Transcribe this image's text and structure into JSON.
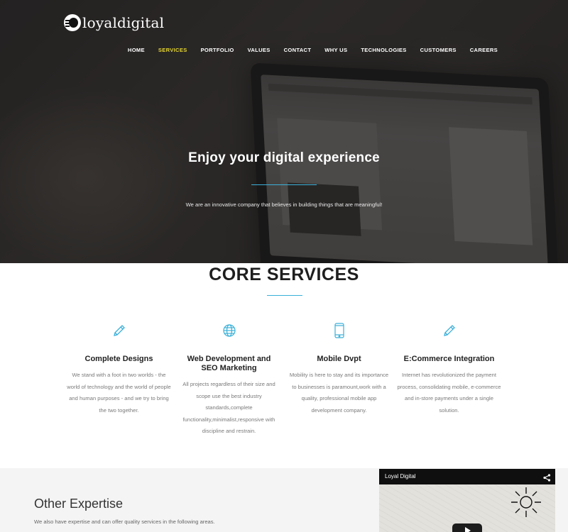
{
  "brand": {
    "name": "loyaldigital"
  },
  "nav": {
    "items": [
      {
        "label": "HOME",
        "active": false
      },
      {
        "label": "SERVICES",
        "active": true
      },
      {
        "label": "PORTFOLIO",
        "active": false
      },
      {
        "label": "VALUES",
        "active": false
      },
      {
        "label": "CONTACT",
        "active": false
      },
      {
        "label": "WHY US",
        "active": false
      },
      {
        "label": "TECHNOLOGIES",
        "active": false
      },
      {
        "label": "CUSTOMERS",
        "active": false
      },
      {
        "label": "CAREERS",
        "active": false
      }
    ]
  },
  "hero": {
    "title": "Enjoy your digital experience",
    "subtitle": "We are an innovative company that believes in building things that are meaningful!"
  },
  "core": {
    "title": "CORE SERVICES",
    "services": [
      {
        "icon": "pencil-icon",
        "title": "Complete Designs",
        "title2": "",
        "text": "We stand with a foot in two worlds - the world of technology and the world of people and human purposes - and we try to bring the two together."
      },
      {
        "icon": "globe-icon",
        "title": "Web Development and",
        "title2": "SEO Marketing",
        "text": "All projects regardless of their size and scope use the best industry standards,complete functionality,minimalist,responsive with discipline and restrain."
      },
      {
        "icon": "mobile-icon",
        "title": "Mobile Dvpt",
        "title2": "",
        "text": "Mobility is here to stay and its importance to businesses is paramount,work with a quality, professional mobile app development company."
      },
      {
        "icon": "pencil-icon",
        "title": "E:Commerce Integration",
        "title2": "",
        "text": "Internet has revolutionized the payment process, consolidating mobile, e-commerce and in-store payments under a single solution."
      }
    ]
  },
  "other": {
    "title": "Other Expertise",
    "text": "We also have expertise and can offer quality services in the following areas."
  },
  "video": {
    "title": "Loyal Digital"
  },
  "colors": {
    "accent": "#3ab0d8",
    "nav_active": "#e4d531"
  }
}
